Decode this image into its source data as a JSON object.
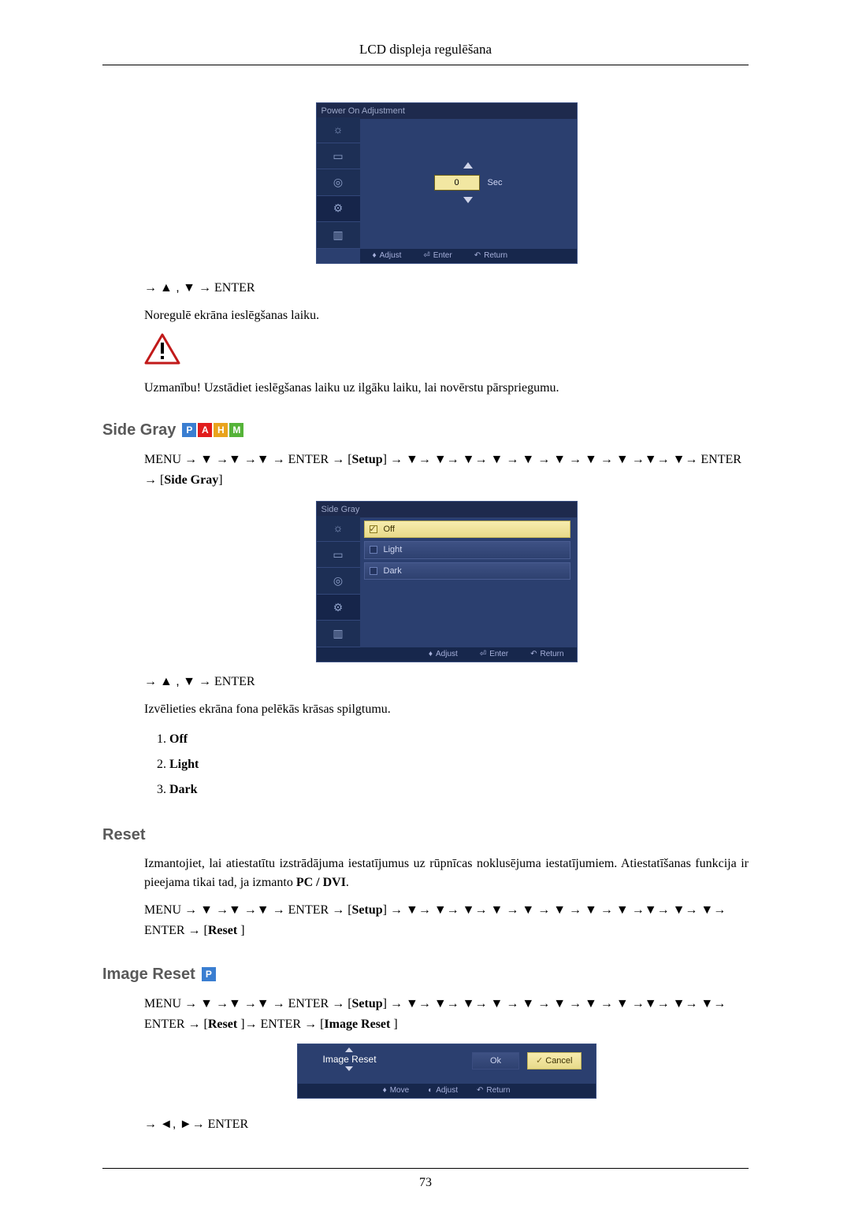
{
  "header": {
    "title": "LCD displeja regulēšana"
  },
  "osd_adjust": {
    "title": "Power On Adjustment",
    "value": "0",
    "unit": "Sec",
    "footer": {
      "adjust": "Adjust",
      "enter": "Enter",
      "return": "Return"
    }
  },
  "line1": {
    "prefix": "→ ",
    "nav": "▲ , ▼",
    "suffix": " → ENTER"
  },
  "para1": "Noregulē ekrāna ieslēgšanas laiku.",
  "para2": "Uzmanību! Uzstādiet ieslēgšanas laiku uz ilgāku laiku, lai novērstu pārspriegumu.",
  "section1": {
    "title": "Side Gray"
  },
  "nav_sidegray": {
    "text": "MENU → ▼ →▼ →▼ → ENTER → [Setup] → ▼→ ▼→ ▼→ ▼ → ▼ → ▼ → ▼ → ▼ →▼→ ▼→ ENTER → [Side Gray]",
    "setup": "Setup",
    "target": "Side Gray"
  },
  "osd_sidegray": {
    "title": "Side Gray",
    "options": [
      "Off",
      "Light",
      "Dark"
    ],
    "selected": "Off",
    "footer": {
      "adjust": "Adjust",
      "enter": "Enter",
      "return": "Return"
    }
  },
  "line2": {
    "prefix": "→ ",
    "nav": "▲ , ▼",
    "suffix": " → ENTER"
  },
  "para3": "Izvēlieties ekrāna fona pelēkās krāsas spilgtumu.",
  "options_list": [
    "Off",
    "Light",
    "Dark"
  ],
  "section2": {
    "title": "Reset"
  },
  "para4_a": "Izmantojiet, lai atiestatītu izstrādājuma iestatījumus uz rūpnīcas noklusējuma iestatījumiem. Atiesta­tīšanas funkcija ir pieejama tikai tad, ja izmanto ",
  "para4_b": "PC / DVI",
  "para4_c": ".",
  "nav_reset": {
    "text": "MENU → ▼ →▼ →▼ → ENTER → [Setup] → ▼→ ▼→ ▼→ ▼ → ▼ → ▼ → ▼ → ▼ →▼→ ▼→ ▼→ ENTER → [Reset ]",
    "setup": "Setup",
    "target": "Reset "
  },
  "section3": {
    "title": "Image Reset"
  },
  "nav_imagereset": {
    "text": "MENU → ▼ →▼ →▼ → ENTER → [Setup] → ▼→ ▼→ ▼→ ▼ → ▼ → ▼ → ▼ → ▼ →▼→ ▼→ ▼→ ENTER → [Reset ]→ ENTER → [Image Reset ]",
    "setup": "Setup",
    "reset": "Reset ",
    "target": "Image Reset "
  },
  "osd_imagereset": {
    "title": "Image Reset",
    "ok": "Ok",
    "cancel": "Cancel",
    "footer": {
      "move": "Move",
      "adjust": "Adjust",
      "return": "Return"
    }
  },
  "line3": {
    "prefix": "→ ",
    "nav": "◄, ►",
    "suffix": "→ ENTER"
  },
  "footer": {
    "page": "73"
  },
  "badge_labels": {
    "p": "P",
    "a": "A",
    "h": "H",
    "m": "M"
  }
}
